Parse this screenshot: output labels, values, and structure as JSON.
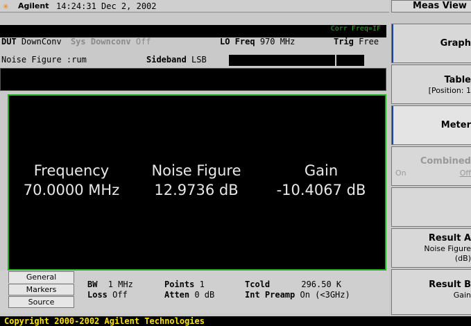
{
  "titlebar": {
    "brand": "Agilent",
    "clock": "14:24:31  Dec 2, 2002"
  },
  "menu": {
    "title": "Meas View",
    "softkeys": [
      {
        "title": "Graph",
        "sub": ""
      },
      {
        "title": "Table",
        "sub": "[Position: 1"
      },
      {
        "title": "Meter",
        "sub": ""
      },
      {
        "title": "Combined",
        "sub_left": "On",
        "sub_right": "Off"
      },
      {
        "title": "",
        "sub": ""
      },
      {
        "title": "Result A",
        "sub": "Noise Figure",
        "sub2": "(dB)"
      },
      {
        "title": "Result B",
        "sub": "Gain"
      }
    ]
  },
  "status": {
    "corr_label": "Corr Freq=IF",
    "dut_label": "DUT",
    "dut_value": "DownConv",
    "sys_label": "Sys Downconv",
    "sys_value": "Off",
    "lo_label": "LO Freq",
    "lo_value": "970 MHz",
    "trig_label": "Trig",
    "trig_value": "Free",
    "nf_label": "Noise Figure :rum",
    "sideband_label": "Sideband",
    "sideband_value": "LSB"
  },
  "meter": {
    "headers": [
      "Frequency",
      "Noise Figure",
      "Gain"
    ],
    "values": [
      "70.0000 MHz",
      "12.9736 dB",
      "-10.4067 dB"
    ]
  },
  "tabs": [
    "General",
    "Markers",
    "Source"
  ],
  "bottom_info": {
    "bw_label": "BW",
    "bw_value": "1 MHz",
    "points_label": "Points",
    "points_value": "1",
    "tcold_label": "Tcold",
    "tcold_value": "296.50 K",
    "loss_label": "Loss",
    "loss_value": "Off",
    "atten_label": "Atten",
    "atten_value": "0 dB",
    "preamp_label": "Int Preamp",
    "preamp_value": "On  (<3GHz)"
  },
  "copyright": "Copyright 2000-2002 Agilent Technologies"
}
